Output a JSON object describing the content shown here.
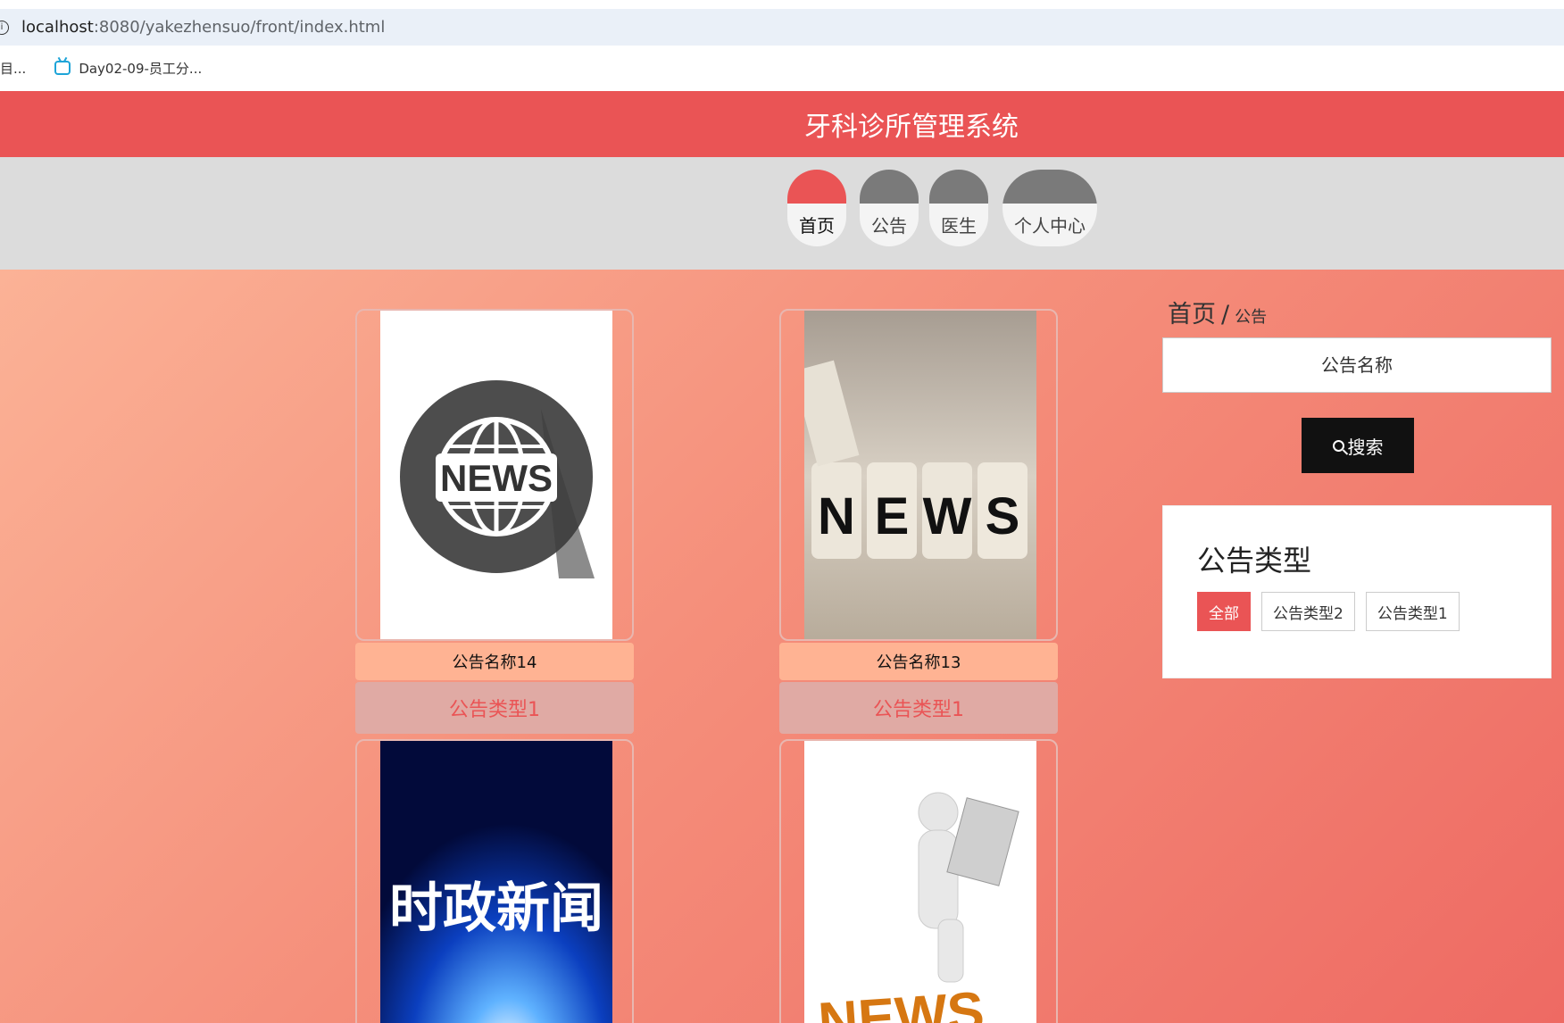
{
  "browser": {
    "url_host": "localhost",
    "url_path": ":8080/yakezhensuo/front/index.html",
    "bookmarks": [
      "目...",
      "Day02-09-员工分..."
    ]
  },
  "header": {
    "title": "牙科诊所管理系统"
  },
  "nav": {
    "items": [
      {
        "label": "首页",
        "active": true
      },
      {
        "label": "公告",
        "active": false
      },
      {
        "label": "医生",
        "active": false
      },
      {
        "label": "个人中心",
        "active": false
      }
    ]
  },
  "breadcrumb": {
    "home": "首页",
    "separator": "/",
    "current": "公告"
  },
  "search": {
    "placeholder": "公告名称",
    "button_label": "搜索"
  },
  "type_panel": {
    "title": "公告类型",
    "tags": [
      {
        "label": "全部",
        "active": true
      },
      {
        "label": "公告类型2",
        "active": false
      },
      {
        "label": "公告类型1",
        "active": false
      }
    ]
  },
  "cards": [
    {
      "name": "公告名称14",
      "type": "公告类型1",
      "image_icon": "globe-news-icon"
    },
    {
      "name": "公告名称13",
      "type": "公告类型1",
      "image_icon": "news-blocks-icon"
    },
    {
      "name": "",
      "type": "",
      "image_icon": "politics-news-icon",
      "image_text": "时政新闻"
    },
    {
      "name": "",
      "type": "",
      "image_icon": "reading-man-news-icon",
      "image_text": "NEWS"
    }
  ],
  "colors": {
    "accent": "#ea5455",
    "nav_bg": "#dcdcdc",
    "card_name_bg": "#ffb393",
    "card_type_bg": "#e0aaa4"
  }
}
